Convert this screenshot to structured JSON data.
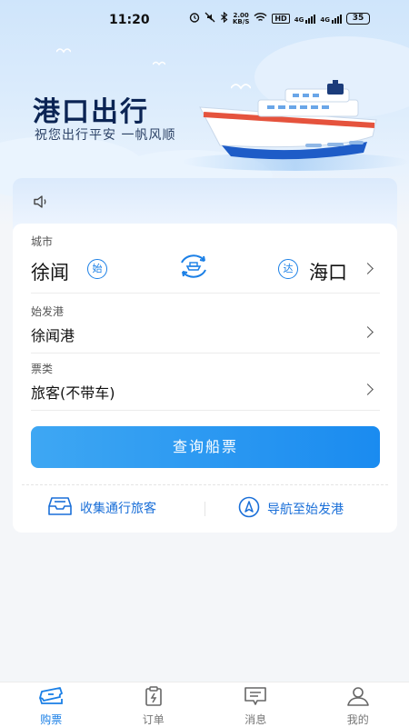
{
  "status_bar": {
    "time": "11:20",
    "network_speed_top": "2.00",
    "network_speed_unit": "KB/S",
    "hd_badge": "HD",
    "signal_1": "4G",
    "signal_2": "4G",
    "battery": "35"
  },
  "header": {
    "title": "港口出行",
    "slogan": "祝您出行平安 一帆风顺"
  },
  "notice": {
    "icon": "speaker-icon",
    "text": ""
  },
  "route": {
    "city_label": "城市",
    "from_city": "徐闻",
    "from_tag": "始",
    "to_city": "海口",
    "to_tag": "达",
    "swap_icon": "ship-swap-icon"
  },
  "departure": {
    "label": "始发港",
    "value": "徐闻港"
  },
  "ticket_type": {
    "label": "票类",
    "value": "旅客(不带车)"
  },
  "query_button": "查询船票",
  "actions": {
    "collect": "收集通行旅客",
    "navigate": "导航至始发港"
  },
  "tabs": [
    {
      "label": "购票",
      "active": true
    },
    {
      "label": "订单",
      "active": false
    },
    {
      "label": "消息",
      "active": false
    },
    {
      "label": "我的",
      "active": false
    }
  ],
  "colors": {
    "accent": "#1a7fe6",
    "title": "#0b2454",
    "hull_red": "#e5533d"
  }
}
